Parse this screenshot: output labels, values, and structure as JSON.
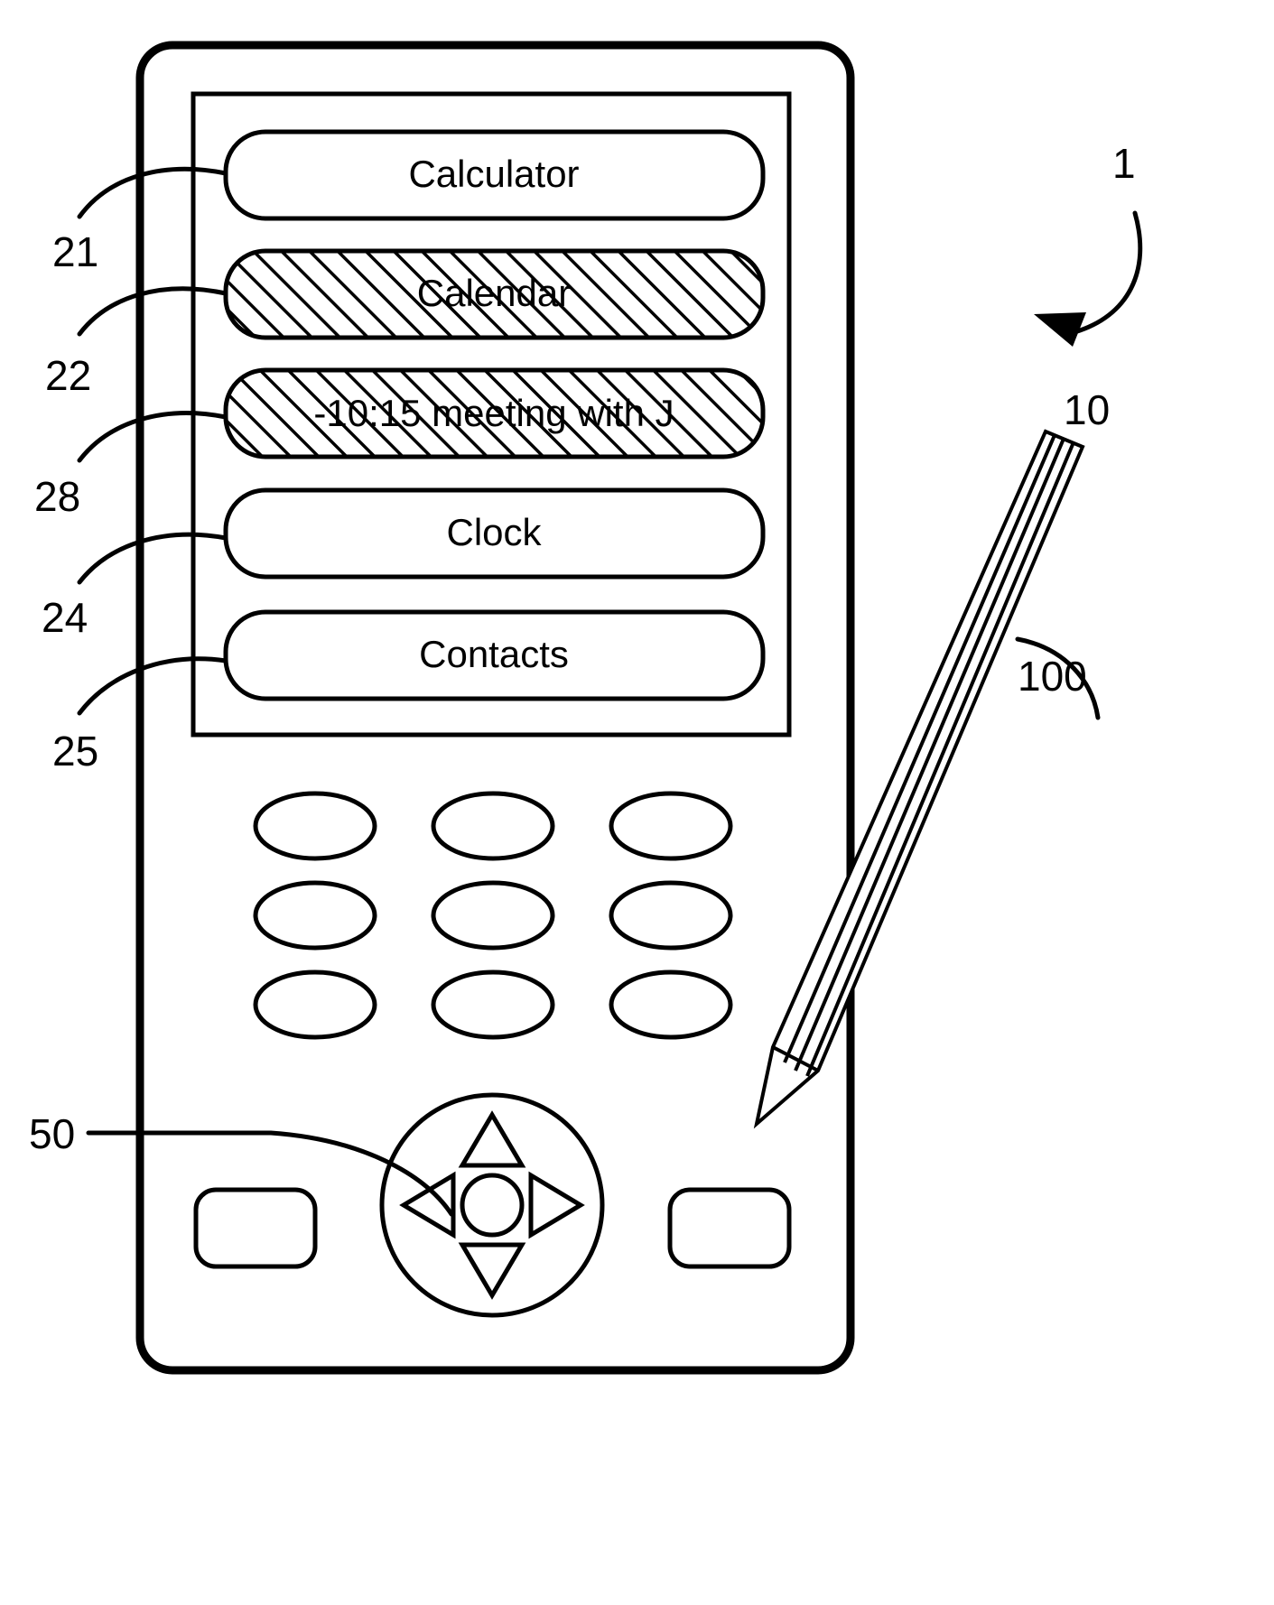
{
  "figure": {
    "background_color": "#ffffff",
    "line_color": "#000000",
    "title": "Handheld electronic device with stylus"
  },
  "device": {
    "reference_numeral": "1",
    "body_label": "10",
    "screen": {
      "menu_items": [
        {
          "label": "Calculator",
          "reference": "21",
          "highlighted": false
        },
        {
          "label": "Calendar",
          "reference": "22",
          "highlighted": true
        },
        {
          "label": "-10:15 meeting with J",
          "reference": "28",
          "highlighted": true
        },
        {
          "label": "Clock",
          "reference": "24",
          "highlighted": false
        },
        {
          "label": "Contacts",
          "reference": "25",
          "highlighted": false
        }
      ]
    },
    "keypad": {
      "rows": 3,
      "columns": 3,
      "key_shape": "ellipse"
    },
    "navigation_pad": {
      "reference_numeral": "50",
      "buttons": [
        "up-triangle",
        "left-triangle",
        "center-circle",
        "right-triangle",
        "down-triangle"
      ]
    },
    "soft_keys": [
      {
        "position": "left"
      },
      {
        "position": "right"
      }
    ]
  },
  "stylus": {
    "reference_numeral": "100"
  },
  "reference_numerals": {
    "device_arrow": "1",
    "device_body": "10",
    "item_calculator": "21",
    "item_calendar": "22",
    "item_appointment": "28",
    "item_clock": "24",
    "item_contacts": "25",
    "nav_pad": "50",
    "stylus": "100"
  }
}
